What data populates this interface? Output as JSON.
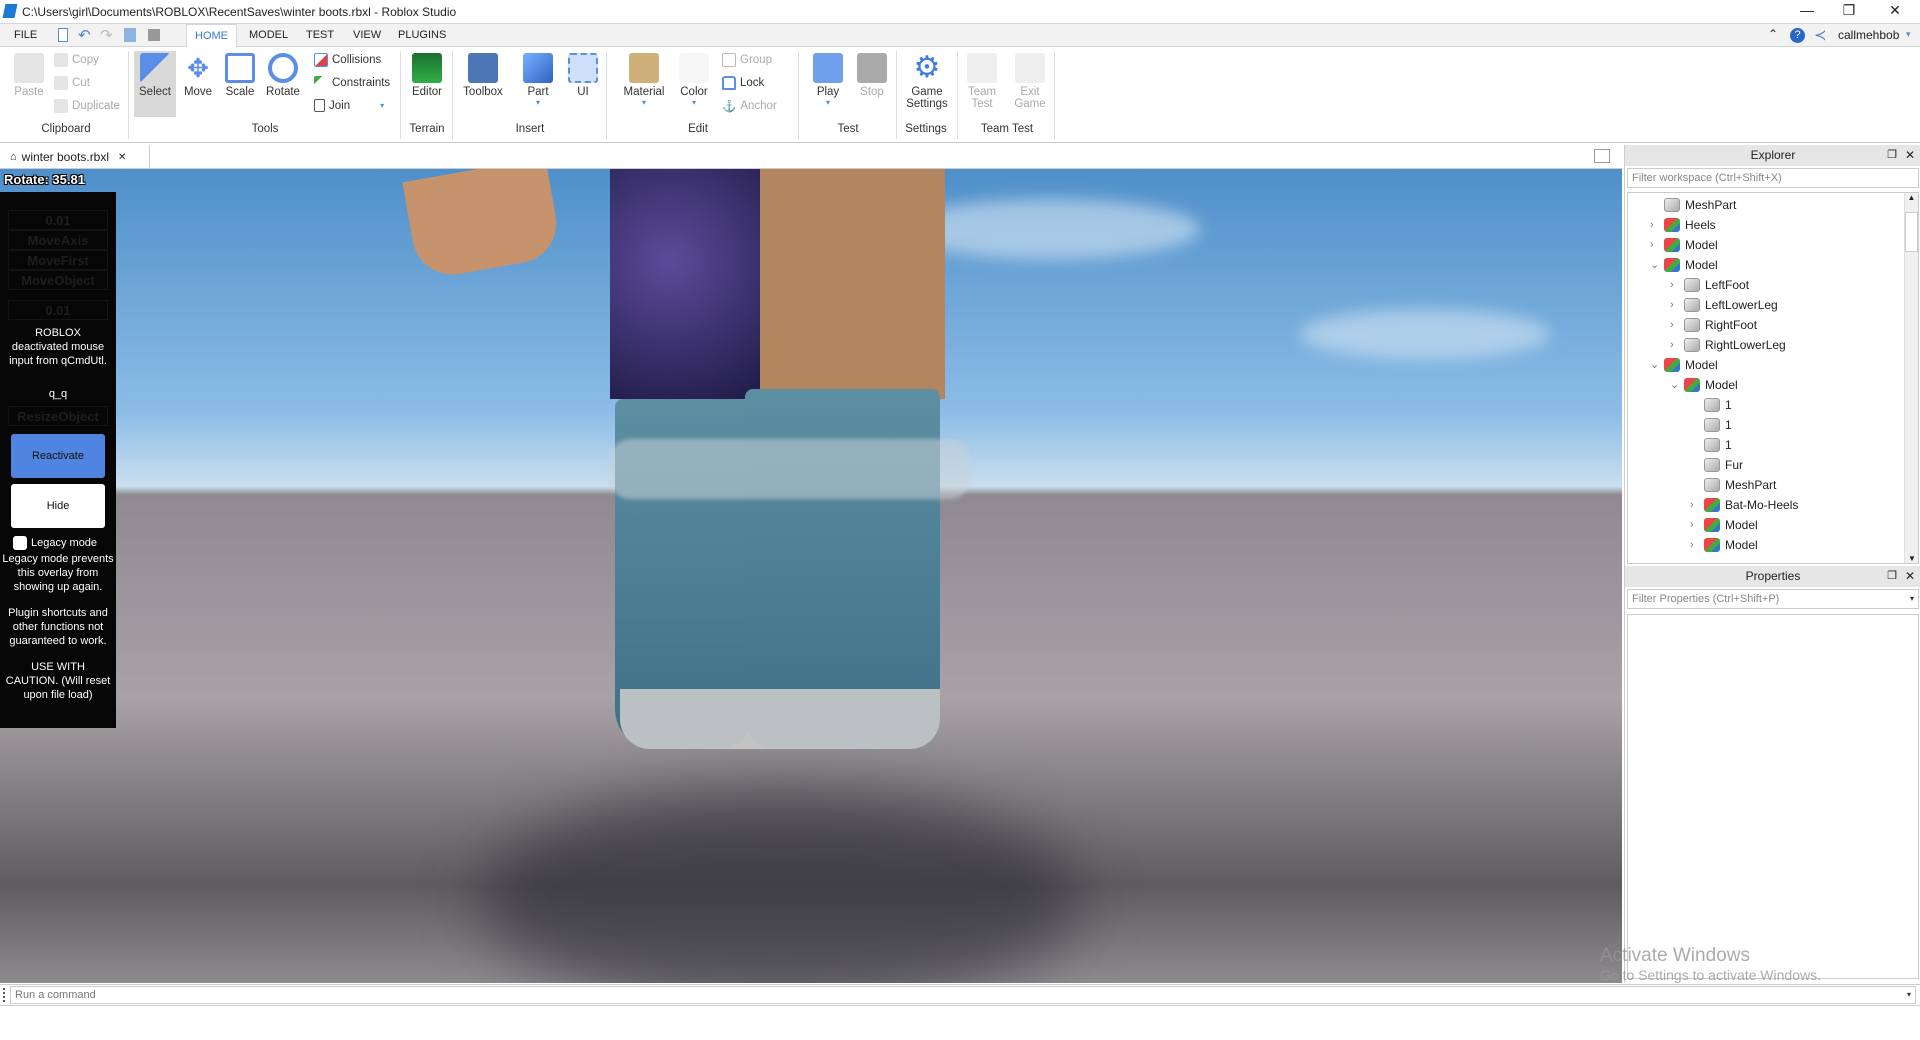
{
  "window": {
    "title": "C:\\Users\\girl\\Documents\\ROBLOX\\RecentSaves\\winter boots.rbxl - Roblox Studio",
    "minimize": "—",
    "restore": "❐",
    "close": "✕"
  },
  "menu": {
    "file": "FILE",
    "tabs": [
      "HOME",
      "MODEL",
      "TEST",
      "VIEW",
      "PLUGINS"
    ],
    "active_tab": "HOME",
    "user": "callmehbob"
  },
  "ribbon": {
    "clipboard": {
      "paste": "Paste",
      "copy": "Copy",
      "cut": "Cut",
      "duplicate": "Duplicate",
      "group": "Clipboard"
    },
    "tools": {
      "select": "Select",
      "move": "Move",
      "scale": "Scale",
      "rotate": "Rotate",
      "collisions": "Collisions",
      "constraints": "Constraints",
      "join": "Join",
      "group": "Tools"
    },
    "terrain": {
      "editor": "Editor",
      "group": "Terrain"
    },
    "insert": {
      "toolbox": "Toolbox",
      "part": "Part",
      "ui": "UI",
      "group": "Insert"
    },
    "edit": {
      "material": "Material",
      "color": "Color",
      "group_btn": "Group",
      "lock": "Lock",
      "anchor": "Anchor",
      "group": "Edit"
    },
    "test": {
      "play": "Play",
      "stop": "Stop",
      "group": "Test"
    },
    "settings": {
      "game_settings": "Game Settings",
      "group": "Settings"
    },
    "team_test": {
      "team_test": "Team Test",
      "exit_game": "Exit Game",
      "group": "Team Test"
    }
  },
  "doc_tab": {
    "label": "winter boots.rbxl",
    "close": "✕"
  },
  "viewport": {
    "rotate_readout": "Rotate: 35.81"
  },
  "overlay": {
    "ghost_items": [
      "0.01",
      "MoveAxis",
      "MoveFirst",
      "MoveObject",
      "0.01"
    ],
    "message": "ROBLOX deactivated mouse input from qCmdUtl.",
    "face": "q_q",
    "ghost_resize": "ResizeObject",
    "reactivate": "Reactivate",
    "hide": "Hide",
    "legacy_label": "Legacy mode",
    "legacy_note": "Legacy mode prevents this overlay from showing up again.",
    "plugin_note": "Plugin shortcuts and other functions not guaranteed to work.",
    "caution": "USE WITH CAUTION. (Will reset upon file load)",
    "accent": "#4f84e0"
  },
  "explorer": {
    "title": "Explorer",
    "filter_placeholder": "Filter workspace (Ctrl+Shift+X)",
    "items": [
      {
        "label": "MeshPart",
        "depth": 0,
        "type": "mesh",
        "expand": ""
      },
      {
        "label": "Heels",
        "depth": 0,
        "type": "model",
        "expand": "›"
      },
      {
        "label": "Model",
        "depth": 0,
        "type": "model",
        "expand": "›"
      },
      {
        "label": "Model",
        "depth": 0,
        "type": "model",
        "expand": "⌄"
      },
      {
        "label": "LeftFoot",
        "depth": 1,
        "type": "mesh",
        "expand": "›"
      },
      {
        "label": "LeftLowerLeg",
        "depth": 1,
        "type": "mesh",
        "expand": "›"
      },
      {
        "label": "RightFoot",
        "depth": 1,
        "type": "mesh",
        "expand": "›"
      },
      {
        "label": "RightLowerLeg",
        "depth": 1,
        "type": "mesh",
        "expand": "›"
      },
      {
        "label": "Model",
        "depth": 0,
        "type": "model",
        "expand": "⌄"
      },
      {
        "label": "Model",
        "depth": 1,
        "type": "model",
        "expand": "⌄"
      },
      {
        "label": "1",
        "depth": 2,
        "type": "mesh",
        "expand": ""
      },
      {
        "label": "1",
        "depth": 2,
        "type": "mesh",
        "expand": ""
      },
      {
        "label": "1",
        "depth": 2,
        "type": "mesh",
        "expand": ""
      },
      {
        "label": "Fur",
        "depth": 2,
        "type": "mesh",
        "expand": ""
      },
      {
        "label": "MeshPart",
        "depth": 2,
        "type": "mesh",
        "expand": ""
      },
      {
        "label": "Bat-Mo-Heels",
        "depth": 2,
        "type": "model",
        "expand": "›"
      },
      {
        "label": "Model",
        "depth": 2,
        "type": "model",
        "expand": "›"
      },
      {
        "label": "Model",
        "depth": 2,
        "type": "model",
        "expand": "›"
      }
    ]
  },
  "properties": {
    "title": "Properties",
    "filter_placeholder": "Filter Properties (Ctrl+Shift+P)"
  },
  "watermark": {
    "line1": "Activate Windows",
    "line2": "Go to Settings to activate Windows."
  },
  "command": {
    "placeholder": "Run a command"
  }
}
